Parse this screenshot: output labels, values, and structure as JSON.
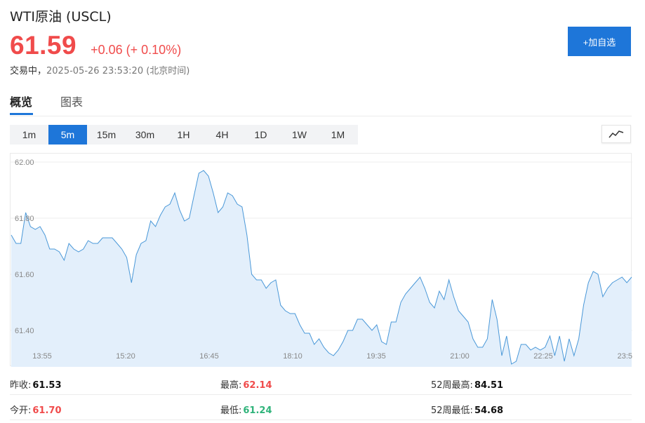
{
  "header": {
    "title": "WTI原油 (USCL)",
    "price": "61.59",
    "change": "+0.06",
    "change_pct": "(+ 0.10%)",
    "status": "交易中，",
    "timestamp": "2025-05-26 23:53:20 (北京时间)"
  },
  "watch_button": {
    "label": "+加自选"
  },
  "tabs": [
    {
      "label": "概览",
      "active": true
    },
    {
      "label": "图表",
      "active": false
    }
  ],
  "periods": [
    {
      "label": "1m",
      "active": false
    },
    {
      "label": "5m",
      "active": true
    },
    {
      "label": "15m",
      "active": false
    },
    {
      "label": "30m",
      "active": false
    },
    {
      "label": "1H",
      "active": false
    },
    {
      "label": "4H",
      "active": false
    },
    {
      "label": "1D",
      "active": false
    },
    {
      "label": "1W",
      "active": false
    },
    {
      "label": "1M",
      "active": false
    }
  ],
  "chart_toggle": {
    "icon": "line-chart-icon"
  },
  "colors": {
    "up": "#f04b4b",
    "down": "#2fb37a",
    "accent": "#1e76d9",
    "line": "#4a98d8",
    "fill": "#e3effb"
  },
  "chart_data": {
    "type": "area",
    "title": "",
    "xlabel": "",
    "ylabel": "",
    "ylim": [
      61.27,
      62.03
    ],
    "yticks": [
      "62.00",
      "61.80",
      "61.60",
      "61.40"
    ],
    "xticks": [
      "13:55",
      "15:20",
      "16:45",
      "18:10",
      "19:35",
      "21:00",
      "22:25",
      "23:5"
    ],
    "grid": true,
    "series": [
      {
        "name": "",
        "values": [
          61.74,
          61.71,
          61.71,
          61.82,
          61.77,
          61.76,
          61.77,
          61.74,
          61.69,
          61.69,
          61.68,
          61.65,
          61.71,
          61.69,
          61.68,
          61.69,
          61.72,
          61.71,
          61.71,
          61.73,
          61.73,
          61.73,
          61.71,
          61.69,
          61.66,
          61.57,
          61.67,
          61.71,
          61.72,
          61.79,
          61.77,
          61.81,
          61.84,
          61.85,
          61.89,
          61.83,
          61.79,
          61.8,
          61.88,
          61.96,
          61.97,
          61.95,
          61.89,
          61.82,
          61.84,
          61.89,
          61.88,
          61.85,
          61.84,
          61.74,
          61.6,
          61.58,
          61.58,
          61.55,
          61.57,
          61.58,
          61.49,
          61.47,
          61.46,
          61.46,
          61.42,
          61.39,
          61.39,
          61.35,
          61.37,
          61.34,
          61.32,
          61.31,
          61.33,
          61.36,
          61.4,
          61.4,
          61.44,
          61.44,
          61.42,
          61.4,
          61.42,
          61.36,
          61.35,
          61.43,
          61.43,
          61.5,
          61.53,
          61.55,
          61.57,
          61.59,
          61.55,
          61.5,
          61.48,
          61.54,
          61.51,
          61.58,
          61.52,
          61.47,
          61.45,
          61.43,
          61.37,
          61.34,
          61.34,
          61.37,
          61.51,
          61.44,
          61.31,
          61.38,
          61.28,
          61.29,
          61.35,
          61.35,
          61.33,
          61.34,
          61.33,
          61.34,
          61.38,
          61.31,
          61.38,
          61.29,
          61.37,
          61.31,
          61.37,
          61.49,
          61.57,
          61.61,
          61.6,
          61.52,
          61.55,
          61.57,
          61.58,
          61.59,
          61.57,
          61.59
        ]
      }
    ]
  },
  "stats": {
    "rows": [
      [
        {
          "label": "昨收:",
          "value": "61.53",
          "tone": "neutral"
        },
        {
          "label": "最高:",
          "value": "62.14",
          "tone": "up"
        },
        {
          "label": "52周最高:",
          "value": "84.51",
          "tone": "neutral"
        }
      ],
      [
        {
          "label": "今开:",
          "value": "61.70",
          "tone": "up"
        },
        {
          "label": "最低:",
          "value": "61.24",
          "tone": "down"
        },
        {
          "label": "52周最低:",
          "value": "54.68",
          "tone": "neutral"
        }
      ]
    ]
  }
}
